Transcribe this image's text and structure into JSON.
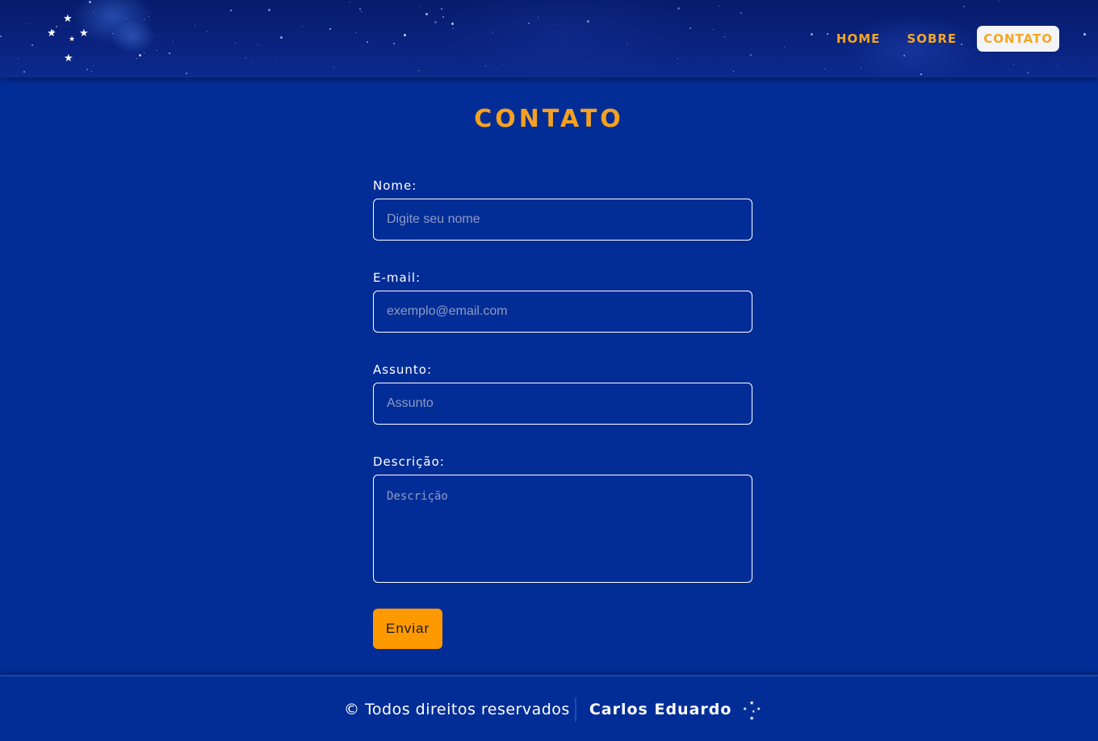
{
  "header": {
    "logo_icon": "southern-cross-icon",
    "nav": [
      {
        "label": "HOME",
        "active": false
      },
      {
        "label": "SOBRE",
        "active": false
      },
      {
        "label": "CONTATO",
        "active": true
      }
    ]
  },
  "main": {
    "title": "CONTATO",
    "form": {
      "nome": {
        "label": "Nome:",
        "placeholder": "Digite seu nome",
        "value": ""
      },
      "email": {
        "label": "E-mail:",
        "placeholder": "exemplo@email.com",
        "value": ""
      },
      "assunto": {
        "label": "Assunto:",
        "placeholder": "Assunto",
        "value": ""
      },
      "descricao": {
        "label": "Descrição:",
        "placeholder": "Descrição",
        "value": ""
      },
      "submit_label": "Enviar"
    }
  },
  "footer": {
    "copyright": "© Todos direitos reservados",
    "author": "Carlos Eduardo",
    "logo_icon": "southern-cross-icon"
  },
  "colors": {
    "background": "#032d96",
    "header_background": "#061c6b",
    "accent": "#f5a11f",
    "button": "#ff9900",
    "active_nav_background": "#f3f4f8"
  }
}
